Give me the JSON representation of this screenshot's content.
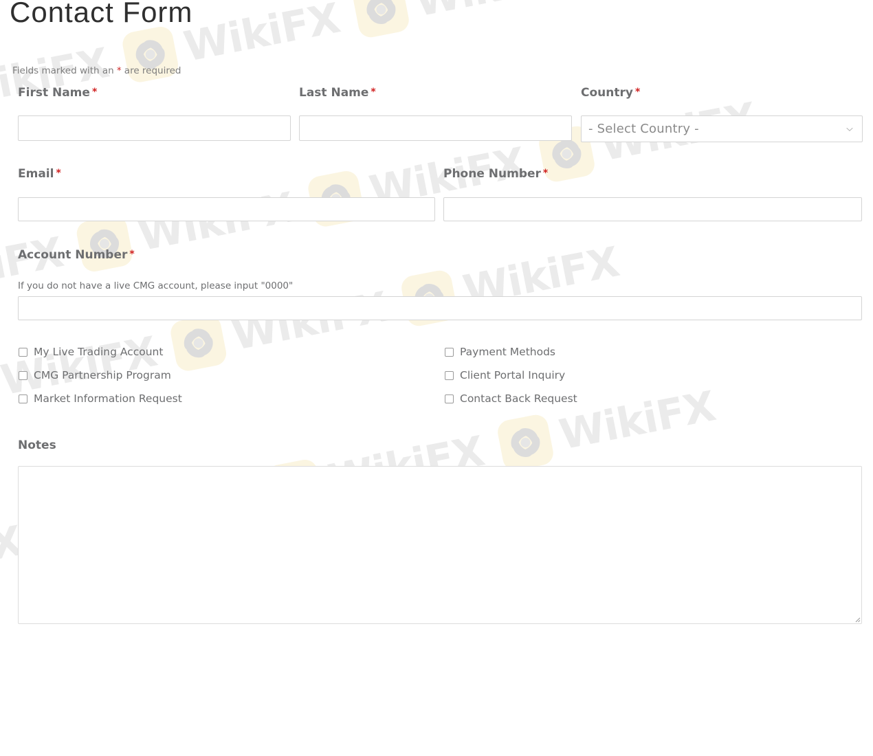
{
  "page": {
    "title": "Contact  Form",
    "required_note_prefix": "Fields marked with an ",
    "required_note_star": "*",
    "required_note_suffix": " are required"
  },
  "fields": {
    "first_name": {
      "label": "First Name",
      "required_mark": "*",
      "value": "",
      "placeholder": ""
    },
    "last_name": {
      "label": "Last Name",
      "required_mark": "*",
      "value": "",
      "placeholder": ""
    },
    "country": {
      "label": "Country",
      "required_mark": "*",
      "selected": "- Select Country -",
      "icon": "chevron-down-icon"
    },
    "email": {
      "label": "Email",
      "required_mark": "*",
      "value": "",
      "placeholder": ""
    },
    "phone": {
      "label": "Phone Number",
      "required_mark": "*",
      "value": "",
      "placeholder": ""
    },
    "account_number": {
      "label": "Account Number",
      "required_mark": "*",
      "hint": "If you do not have a live CMG account, please input \"0000\"",
      "value": "",
      "placeholder": ""
    },
    "notes": {
      "label": "Notes",
      "value": "",
      "placeholder": ""
    }
  },
  "checkboxes": {
    "left": [
      {
        "label": "My Live Trading Account",
        "checked": false
      },
      {
        "label": "CMG Partnership Program",
        "checked": false
      },
      {
        "label": "Market Information Request",
        "checked": false
      }
    ],
    "right": [
      {
        "label": "Payment Methods",
        "checked": false
      },
      {
        "label": "Client Portal Inquiry",
        "checked": false
      },
      {
        "label": "Contact Back Request",
        "checked": false
      }
    ]
  },
  "watermark": {
    "text": "WikiFX",
    "logo_icon": "wikifx-eagle-logo-icon",
    "badge_color": "#fbf5e1",
    "text_color": "#ebebeb"
  },
  "colors": {
    "title": "#2f2f2f",
    "label": "#6d6e70",
    "required_star": "#d02020",
    "input_border": "#d4d4d4",
    "background": "#ffffff"
  }
}
